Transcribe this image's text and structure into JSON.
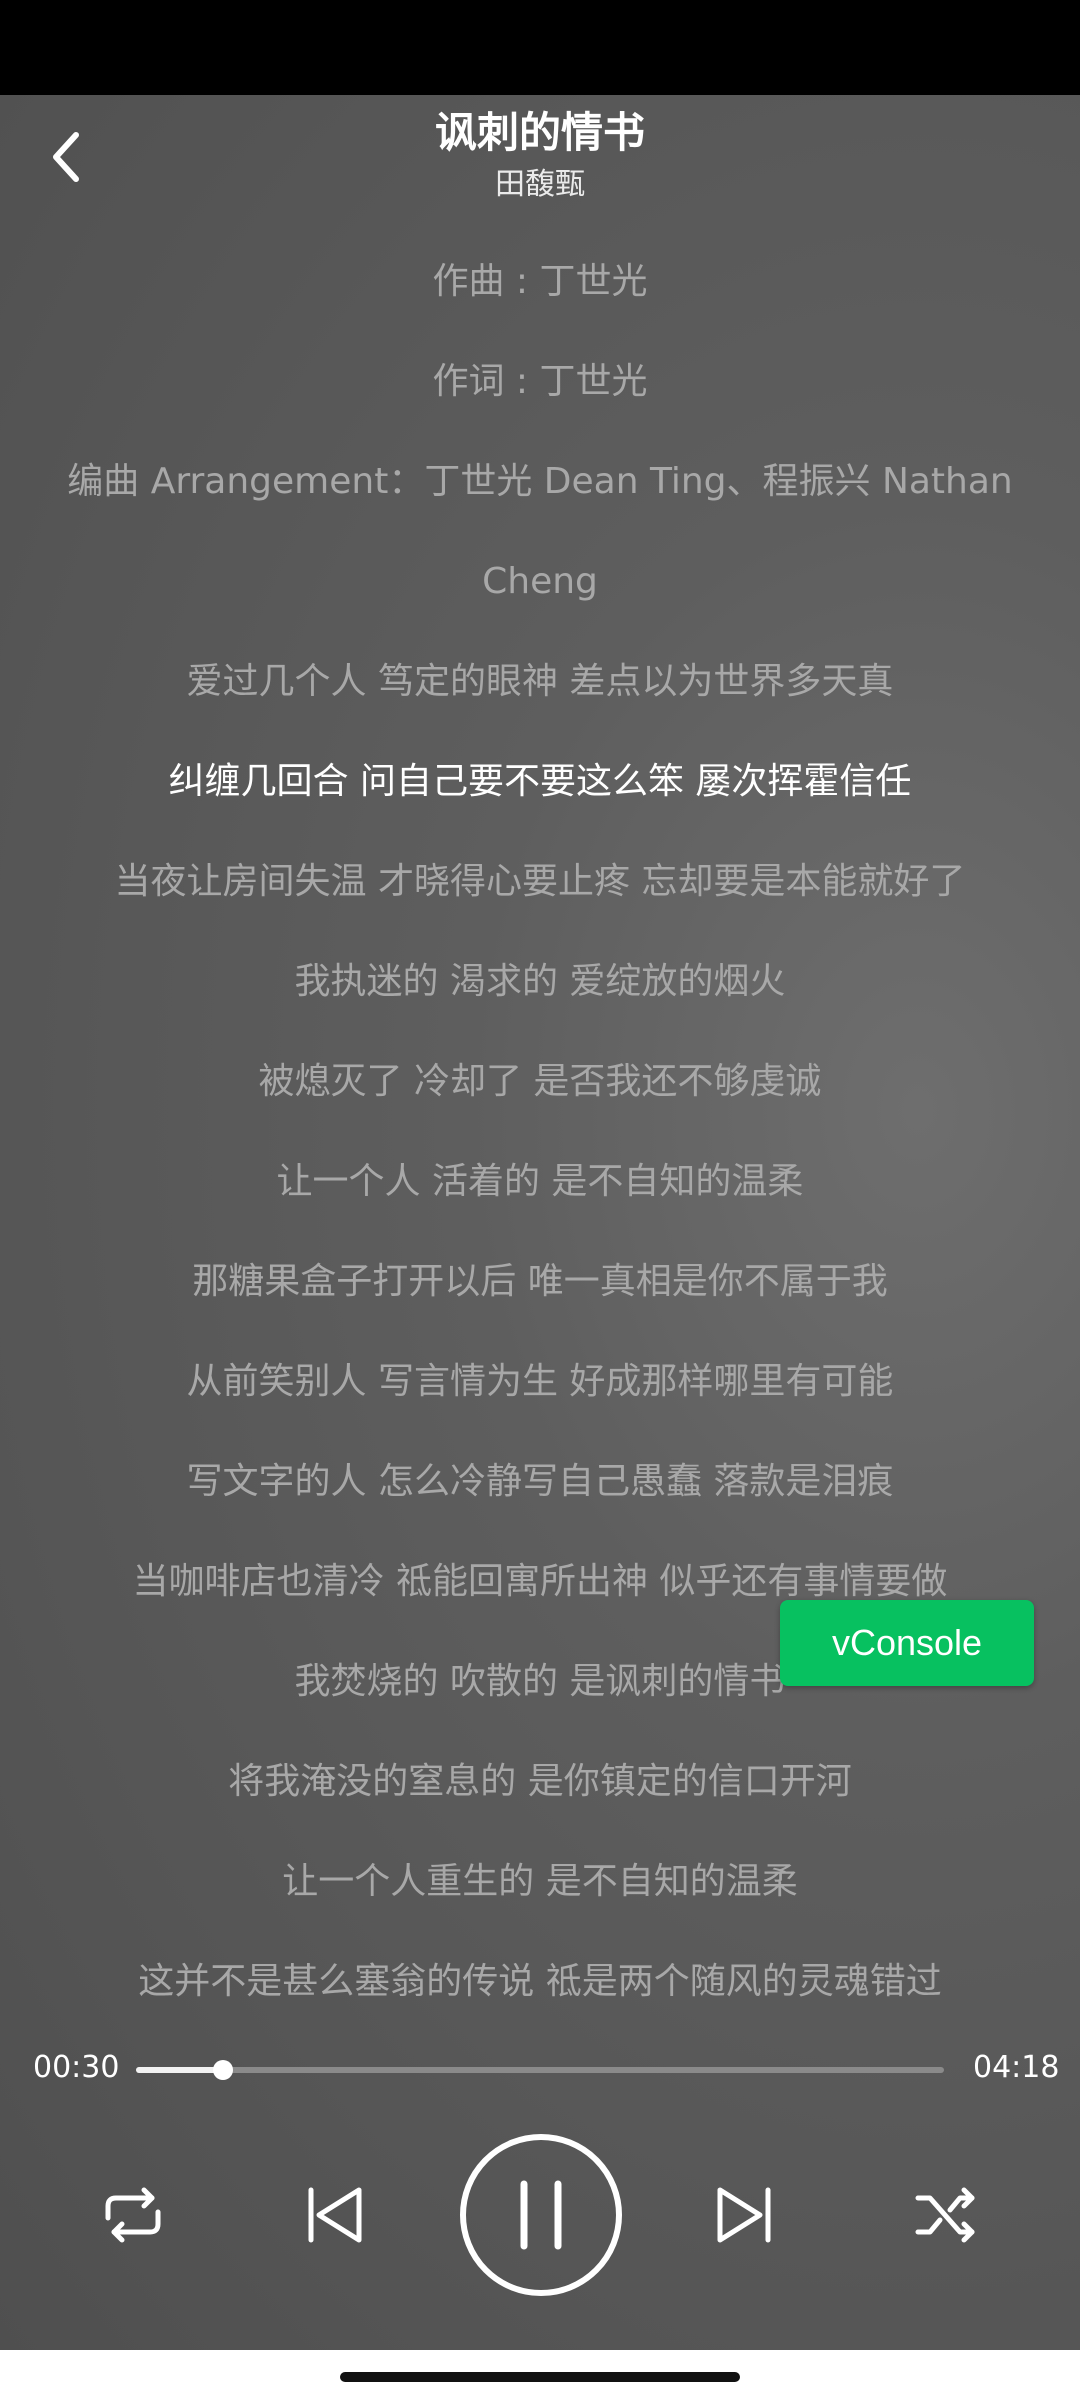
{
  "song": {
    "title": "讽刺的情书",
    "artist": "田馥甄"
  },
  "lyrics": [
    "作曲 : 丁世光",
    "作词 : 丁世光",
    "编曲 Arrangement：丁世光 Dean Ting、程振兴 Nathan Cheng",
    "爱过几个人 笃定的眼神 差点以为世界多天真",
    "纠缠几回合 问自己要不要这么笨 屡次挥霍信任",
    "当夜让房间失温 才晓得心要止疼 忘却要是本能就好了",
    "我执迷的 渴求的 爱绽放的烟火",
    "被熄灭了 冷却了 是否我还不够虔诚",
    "让一个人 活着的 是不自知的温柔",
    "那糖果盒子打开以后 唯一真相是你不属于我",
    "从前笑别人 写言情为生 好成那样哪里有可能",
    "写文字的人 怎么冷静写自己愚蠢 落款是泪痕",
    "当咖啡店也清冷 祗能回寓所出神 似乎还有事情要做",
    "我焚烧的 吹散的 是讽刺的情书",
    "将我淹没的窒息的 是你镇定的信口开河",
    "让一个人重生的 是不自知的温柔",
    "这并不是甚么塞翁的传说 祗是两个随风的灵魂错过"
  ],
  "active_line_index": 4,
  "progress": {
    "current": "00:30",
    "total": "04:18",
    "fraction": 0.108
  },
  "controls": {
    "repeat": "repeat-icon",
    "previous": "skip-previous-icon",
    "play_pause": "pause-icon",
    "next": "skip-next-icon",
    "shuffle": "shuffle-icon"
  },
  "vconsole": {
    "label": "vConsole",
    "color": "#07c160"
  }
}
